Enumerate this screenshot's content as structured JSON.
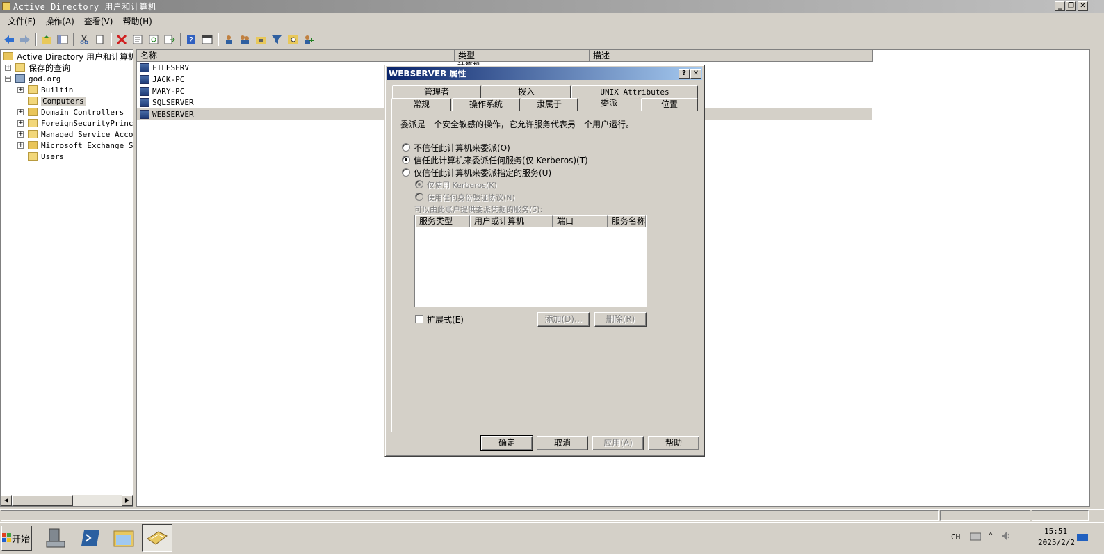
{
  "window": {
    "title": "Active Directory 用户和计算机"
  },
  "menu": [
    "文件(F)",
    "操作(A)",
    "查看(V)",
    "帮助(H)"
  ],
  "tree": {
    "root": "Active Directory 用户和计算机",
    "saved_queries": "保存的查询",
    "domain": "god.org",
    "children": [
      "Builtin",
      "Computers",
      "Domain Controllers",
      "ForeignSecurityPrincipals",
      "Managed Service Accounts",
      "Microsoft Exchange Security Groups",
      "Users"
    ]
  },
  "list": {
    "columns": [
      "名称",
      "类型",
      "描述"
    ],
    "rows": [
      "FILESERV",
      "JACK-PC",
      "MARY-PC",
      "SQLSERVER",
      "WEBSERVER"
    ],
    "partial_type": "计算机"
  },
  "dialog": {
    "title": "WEBSERVER 属性",
    "help_btn": "?",
    "close_btn": "✕",
    "tabs_row1": [
      "管理者",
      "拨入",
      "UNIX Attributes"
    ],
    "tabs_row2": [
      "常规",
      "操作系统",
      "隶属于",
      "委派",
      "位置"
    ],
    "active_tab": "委派",
    "description": "委派是一个安全敏感的操作，它允许服务代表另一个用户运行。",
    "options": [
      "不信任此计算机来委派(O)",
      "信任此计算机来委派任何服务(仅 Kerberos)(T)",
      "仅信任此计算机来委派指定的服务(U)"
    ],
    "selected_option": 1,
    "sub_options": [
      "仅使用 Kerberos(K)",
      "使用任何身份验证协议(N)"
    ],
    "services_label": "可以由此账户提供委派凭据的服务(S):",
    "service_columns": [
      "服务类型",
      "用户或计算机",
      "端口",
      "服务名称"
    ],
    "expanded_label": "扩展式(E)",
    "add_btn": "添加(D)...",
    "remove_btn": "删除(R)",
    "buttons": {
      "ok": "确定",
      "cancel": "取消",
      "apply": "应用(A)",
      "help": "帮助"
    }
  },
  "taskbar": {
    "start": "开始",
    "lang": "CH",
    "time": "15:51",
    "date": "2025/2/2"
  }
}
